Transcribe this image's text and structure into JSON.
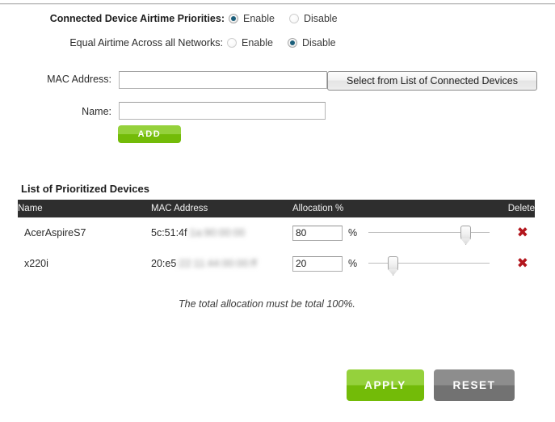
{
  "settings": {
    "rows": [
      {
        "label": "Connected Device Airtime Priorities:",
        "enable_label": "Enable",
        "disable_label": "Disable",
        "selected": "Enable"
      },
      {
        "label": "Equal Airtime Across all Networks:",
        "enable_label": "Enable",
        "disable_label": "Disable",
        "selected": "Disable"
      }
    ]
  },
  "form": {
    "mac_label": "MAC Address:",
    "mac_value": "",
    "mac_placeholder": "",
    "name_label": "Name:",
    "name_value": "",
    "name_placeholder": "",
    "select_button_label": "Select from List of Connected Devices",
    "add_button_label": "ADD"
  },
  "list": {
    "heading": "List of Prioritized Devices",
    "columns": {
      "name": "Name",
      "mac": "MAC Address",
      "allocation": "Allocation %",
      "delete": "Delete"
    },
    "rows": [
      {
        "name": "AcerAspireS7",
        "mac_visible": "5c:51:4f",
        "mac_redacted": ":1a:90:00:00",
        "allocation": "80",
        "percent_sign": "%",
        "delete_icon": "red-x-icon"
      },
      {
        "name": "x220i",
        "mac_visible": "20:e5",
        "mac_redacted": ":22:11:44:00:00:ff",
        "allocation": "20",
        "percent_sign": "%",
        "delete_icon": "red-x-icon"
      }
    ],
    "note": "The total allocation must be total 100%."
  },
  "footer": {
    "apply_label": "APPLY",
    "reset_label": "RESET"
  },
  "colors": {
    "accent_green": "#73bb08",
    "accent_green_light": "#95d13c",
    "grey_button": "#727272",
    "header_bar": "#2e2e2e",
    "radio_selected": "#1b5e7a",
    "delete_red": "#b3161d"
  }
}
